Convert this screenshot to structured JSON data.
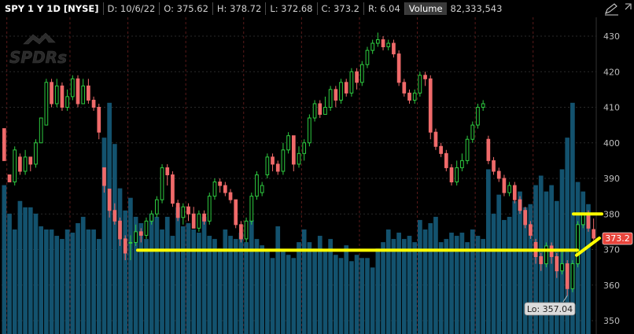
{
  "header": {
    "symbol": "SPY 1 Y 1D [NYSE]",
    "date": "D: 10/6/22",
    "open": "O: 375.62",
    "high": "H: 378.72",
    "low": "L: 372.68",
    "close": "C: 373.2",
    "range": "R: 6.04",
    "volume_label": "Volume",
    "volume_value": "82,333,543"
  },
  "watermark": "SPDRs",
  "price_tag": "373.2",
  "low_label": "Lo: 357.04",
  "icons": {
    "settings": "pencil-icon",
    "expand": "expand-icon"
  },
  "colors": {
    "up": "#2ecc40",
    "down": "#f06a6a",
    "volume": "#13526e",
    "annotation": "#ffff00",
    "price_tag": "#e8453c"
  },
  "chart_data": {
    "type": "candlestick",
    "y_ticks": [
      350,
      360,
      370,
      380,
      390,
      400,
      410,
      420,
      430
    ],
    "ylim": [
      348,
      436
    ],
    "annotations": {
      "support_line": 369.8,
      "resistance_line": 380.0,
      "trend_from": 370.6,
      "trend_to": 373.2,
      "session_low": 357.04
    },
    "candles": [
      [
        404,
        395,
        404,
        395
      ],
      [
        391,
        389,
        391,
        389
      ],
      [
        389,
        398,
        399,
        388
      ],
      [
        396,
        392,
        397,
        391
      ],
      [
        392,
        396,
        398,
        391
      ],
      [
        396,
        394,
        396,
        392
      ],
      [
        394,
        400,
        401,
        393
      ],
      [
        400,
        407,
        407,
        400
      ],
      [
        405,
        417,
        418,
        405
      ],
      [
        417,
        411,
        418,
        410
      ],
      [
        411,
        416,
        418,
        410
      ],
      [
        416,
        410,
        417,
        409
      ],
      [
        410,
        413,
        415,
        409
      ],
      [
        413,
        418,
        419,
        412
      ],
      [
        418,
        411,
        419,
        410
      ],
      [
        411,
        416,
        418,
        411
      ],
      [
        416,
        412,
        418,
        411
      ],
      [
        412,
        410,
        413,
        409
      ],
      [
        410,
        403,
        411,
        401
      ],
      [
        393,
        388,
        393,
        386
      ],
      [
        387,
        381,
        387,
        379
      ],
      [
        381,
        378,
        383,
        377
      ],
      [
        378,
        373,
        379,
        371
      ],
      [
        373,
        369,
        374,
        367
      ],
      [
        372,
        372,
        374,
        367
      ],
      [
        372,
        375,
        377,
        371
      ],
      [
        375,
        374,
        376,
        372
      ],
      [
        374,
        378,
        379,
        373
      ],
      [
        378,
        380,
        381,
        377
      ],
      [
        380,
        384,
        385,
        379
      ],
      [
        384,
        393,
        394,
        383
      ],
      [
        393,
        391,
        394,
        388
      ],
      [
        391,
        383,
        392,
        382
      ],
      [
        383,
        379,
        384,
        378
      ],
      [
        379,
        382,
        383,
        377
      ],
      [
        382,
        380,
        383,
        378
      ],
      [
        380,
        376,
        382,
        376
      ],
      [
        376,
        380,
        381,
        375
      ],
      [
        380,
        378,
        381,
        377
      ],
      [
        378,
        385,
        386,
        377
      ],
      [
        385,
        389,
        390,
        384
      ],
      [
        389,
        388,
        390,
        386
      ],
      [
        388,
        386,
        389,
        385
      ],
      [
        386,
        384,
        387,
        383
      ],
      [
        384,
        377,
        384,
        376
      ],
      [
        377,
        373,
        378,
        372
      ],
      [
        373,
        378,
        379,
        372
      ],
      [
        378,
        385,
        386,
        377
      ],
      [
        385,
        391,
        392,
        384
      ],
      [
        386,
        388,
        389,
        385
      ],
      [
        391,
        396,
        397,
        390
      ],
      [
        396,
        394,
        397,
        392
      ],
      [
        394,
        392,
        395,
        391
      ],
      [
        392,
        398,
        400,
        391
      ],
      [
        398,
        402,
        403,
        397
      ],
      [
        402,
        394,
        402,
        392
      ],
      [
        394,
        397,
        399,
        393
      ],
      [
        397,
        400,
        401,
        395
      ],
      [
        400,
        407,
        408,
        399
      ],
      [
        407,
        411,
        412,
        406
      ],
      [
        411,
        408,
        412,
        407
      ],
      [
        408,
        410,
        413,
        408
      ],
      [
        410,
        415,
        416,
        409
      ],
      [
        415,
        412,
        416,
        410
      ],
      [
        412,
        417,
        418,
        411
      ],
      [
        417,
        414,
        418,
        413
      ],
      [
        414,
        420,
        421,
        413
      ],
      [
        420,
        417,
        421,
        415
      ],
      [
        417,
        422,
        423,
        416
      ],
      [
        422,
        426,
        427,
        421
      ],
      [
        426,
        428,
        429,
        425
      ],
      [
        428,
        429,
        431,
        427
      ],
      [
        429,
        427,
        430,
        426
      ],
      [
        427,
        428,
        429,
        426
      ],
      [
        428,
        425,
        429,
        424
      ],
      [
        425,
        417,
        426,
        416
      ],
      [
        417,
        414,
        418,
        413
      ],
      [
        414,
        412,
        415,
        411
      ],
      [
        412,
        414,
        415,
        411
      ],
      [
        414,
        419,
        420,
        413
      ],
      [
        419,
        418,
        420,
        416
      ],
      [
        418,
        403,
        419,
        401
      ],
      [
        403,
        399,
        404,
        398
      ],
      [
        399,
        397,
        400,
        396
      ],
      [
        397,
        393,
        398,
        392
      ],
      [
        393,
        389,
        394,
        388
      ],
      [
        389,
        393,
        395,
        388
      ],
      [
        393,
        395,
        397,
        392
      ],
      [
        395,
        401,
        402,
        394
      ],
      [
        401,
        405,
        406,
        400
      ],
      [
        405,
        410,
        411,
        404
      ],
      [
        410,
        411,
        412,
        409
      ],
      [
        401,
        395,
        402,
        394
      ],
      [
        395,
        392,
        396,
        391
      ],
      [
        392,
        390,
        393,
        389
      ],
      [
        390,
        386,
        391,
        385
      ],
      [
        386,
        388,
        389,
        385
      ],
      [
        388,
        384,
        389,
        383
      ],
      [
        384,
        381,
        385,
        380
      ],
      [
        381,
        377,
        382,
        376
      ],
      [
        377,
        374,
        378,
        373
      ],
      [
        372,
        368,
        373,
        366
      ],
      [
        368,
        366,
        369,
        364
      ],
      [
        366,
        371,
        372,
        365
      ],
      [
        371,
        368,
        372,
        366
      ],
      [
        368,
        364,
        369,
        362
      ],
      [
        364,
        366,
        370,
        363
      ],
      [
        366,
        359,
        367,
        357
      ],
      [
        359,
        366,
        367,
        358
      ],
      [
        366,
        377,
        378,
        365
      ],
      [
        377,
        380,
        380,
        376
      ],
      [
        380,
        376,
        381,
        375
      ],
      [
        375.62,
        373.2,
        378.72,
        372.68
      ]
    ],
    "volume_pct": [
      0.47,
      0.38,
      0.33,
      0.42,
      0.4,
      0.4,
      0.38,
      0.34,
      0.33,
      0.33,
      0.31,
      0.3,
      0.33,
      0.32,
      0.35,
      0.37,
      0.33,
      0.33,
      0.3,
      0.62,
      0.73,
      0.6,
      0.46,
      0.39,
      0.43,
      0.37,
      0.35,
      0.3,
      0.38,
      0.37,
      0.33,
      0.37,
      0.31,
      0.4,
      0.34,
      0.35,
      0.33,
      0.32,
      0.37,
      0.31,
      0.3,
      0.27,
      0.33,
      0.31,
      0.3,
      0.32,
      0.29,
      0.36,
      0.3,
      0.28,
      0.26,
      0.24,
      0.34,
      0.26,
      0.25,
      0.24,
      0.29,
      0.33,
      0.29,
      0.27,
      0.31,
      0.26,
      0.3,
      0.25,
      0.24,
      0.28,
      0.23,
      0.25,
      0.24,
      0.24,
      0.21,
      0.27,
      0.29,
      0.33,
      0.3,
      0.32,
      0.3,
      0.31,
      0.29,
      0.36,
      0.33,
      0.35,
      0.37,
      0.29,
      0.3,
      0.32,
      0.31,
      0.32,
      0.29,
      0.33,
      0.31,
      0.3,
      0.52,
      0.38,
      0.44,
      0.36,
      0.37,
      0.42,
      0.45,
      0.4,
      0.41,
      0.47,
      0.5,
      0.45,
      0.47,
      0.42,
      0.52,
      0.62,
      0.73,
      0.48,
      0.45,
      0.41
    ]
  }
}
